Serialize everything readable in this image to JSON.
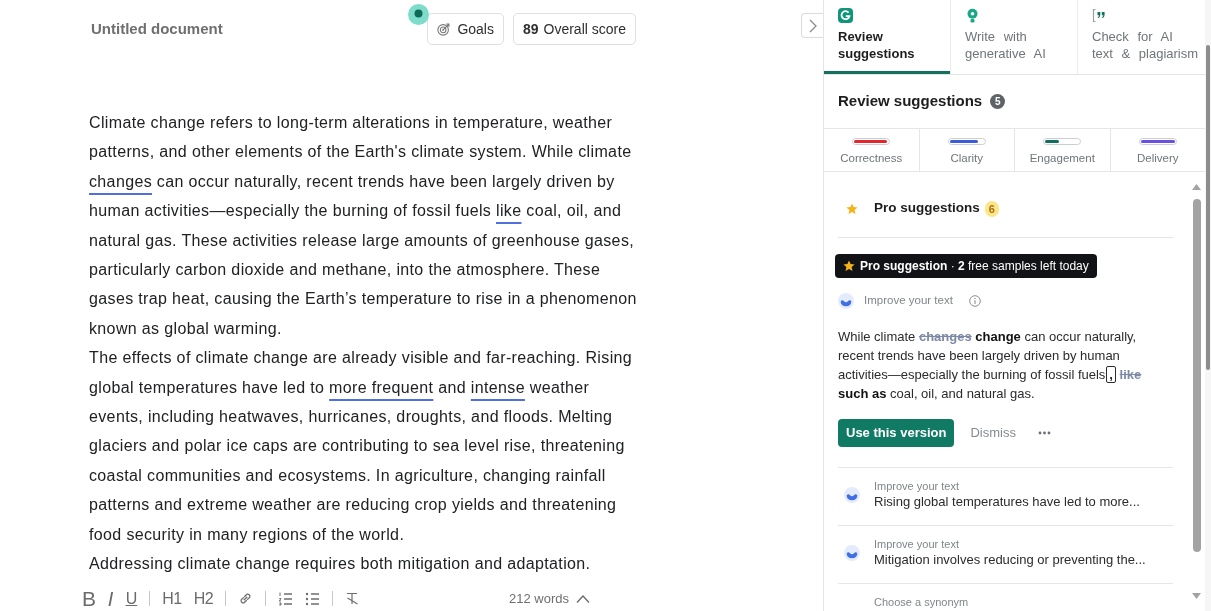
{
  "document": {
    "title": "Untitled document",
    "goals_button": "Goals",
    "score": {
      "value": "89",
      "label": "Overall score"
    }
  },
  "editor": {
    "paragraphs": [
      {
        "segments": [
          {
            "kind": "text",
            "text": "Climate change refers to long-term alterations in temperature, weather patterns, and other elements of the Earth's climate system. While climate "
          },
          {
            "kind": "flagged",
            "text": "changes"
          },
          {
            "kind": "text",
            "text": " can occur naturally, recent trends have been largely driven by human activities—especially the burning of fossil fuels "
          },
          {
            "kind": "flagged",
            "text": "like"
          },
          {
            "kind": "text",
            "text": " coal, oil, and natural gas. These activities release large amounts of greenhouse gases, particularly carbon dioxide and methane, into the atmosphere. These gases trap heat, causing the Earth’s temperature to rise in a phenomenon known as global warming."
          }
        ]
      },
      {
        "segments": [
          {
            "kind": "text",
            "text": "The effects of climate change are already visible and far-reaching. Rising global temperatures have led to "
          },
          {
            "kind": "flagged",
            "text": "more frequent"
          },
          {
            "kind": "text",
            "text": " and "
          },
          {
            "kind": "flagged",
            "text": "intense"
          },
          {
            "kind": "text",
            "text": " weather events, including heatwaves, hurricanes, droughts, and floods. Melting glaciers and polar ice caps are contributing to sea level rise, threatening coastal communities and ecosystems. In agriculture, changing rainfall patterns and extreme weather are reducing crop yields and threatening food security in many regions of the world."
          }
        ]
      },
      {
        "segments": [
          {
            "kind": "text",
            "text": "Addressing climate change requires both mitigation and adaptation."
          }
        ]
      }
    ]
  },
  "toolbar": {
    "buttons": [
      {
        "kind": "bold",
        "label": "B"
      },
      {
        "kind": "italic",
        "label": "I"
      },
      {
        "kind": "underline",
        "label": "U"
      },
      {
        "kind": "separator"
      },
      {
        "kind": "heading",
        "label": "H1"
      },
      {
        "kind": "heading",
        "label": "H2"
      },
      {
        "kind": "separator"
      },
      {
        "kind": "link"
      },
      {
        "kind": "separator"
      },
      {
        "kind": "numbered_list"
      },
      {
        "kind": "bullet_list"
      },
      {
        "kind": "separator"
      },
      {
        "kind": "clear_format"
      }
    ],
    "word_count": "212 words"
  },
  "panel": {
    "tabs": [
      {
        "kind": "logo",
        "label": "Review suggestions",
        "selected": true
      },
      {
        "kind": "bulb",
        "label": "Write with generative AI",
        "selected": false
      },
      {
        "kind": "quote",
        "label": "Check for AI text & plagiarism",
        "selected": false
      }
    ],
    "heading": "Review suggestions",
    "count": "5",
    "categories": [
      {
        "label": "Correctness",
        "level": 0.95,
        "color": "#e3262b"
      },
      {
        "label": "Clarity",
        "level": 0.82,
        "color": "#3d5bd6"
      },
      {
        "label": "Engagement",
        "level": 0.4,
        "color": "#11705d"
      },
      {
        "label": "Delivery",
        "level": 1,
        "color": "#6a4fe0"
      }
    ],
    "pro": {
      "label": "Pro suggestions",
      "count": "6"
    },
    "banner": "**Pro suggestion** · **2** free samples left today",
    "active_card": {
      "type_label": "Improve your text",
      "segments": [
        {
          "kind": "text",
          "text": "While climate "
        },
        {
          "kind": "deleted",
          "text": "changes"
        },
        {
          "kind": "inserted",
          "text": "change"
        },
        {
          "kind": "text",
          "text": " can occur naturally, recent trends have been largely driven by human activities—especially the burning of fossil fuels"
        },
        {
          "kind": "inserted_mark",
          "text": ","
        },
        {
          "kind": "deleted",
          "text": "like"
        },
        {
          "kind": "inserted",
          "text": "such as"
        },
        {
          "kind": "text",
          "text": " coal, oil, and natural gas."
        }
      ],
      "primary_button": "Use this version",
      "secondary_button": "Dismiss"
    },
    "items": [
      {
        "kind": "improve",
        "type_label": "Improve your text",
        "text": "Rising global temperatures have led to more..."
      },
      {
        "kind": "improve",
        "type_label": "Improve your text",
        "text": "Mitigation involves reducing or preventing the..."
      },
      {
        "kind": "synonym",
        "type_label": "Choose a synonym"
      }
    ]
  }
}
